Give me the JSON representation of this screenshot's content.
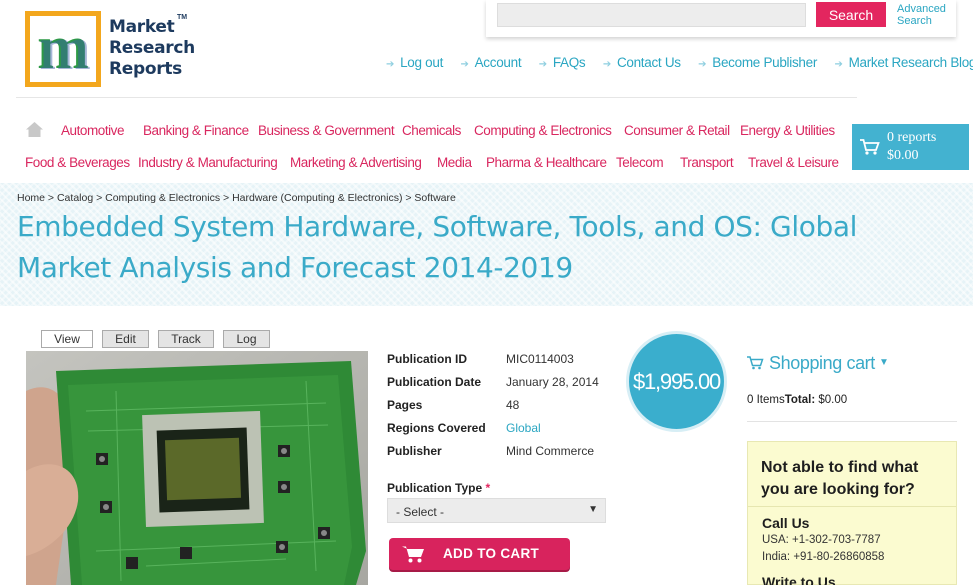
{
  "logo": {
    "line1": "Market",
    "line2": "Research",
    "line3": "Reports",
    "tm": "TM",
    "letter": "m"
  },
  "search": {
    "placeholder": "",
    "button_label": "Search",
    "advanced_label": "Advanced Search"
  },
  "top_links": [
    "Log out",
    "Account",
    "FAQs",
    "Contact Us",
    "Become Publisher",
    "Market Research Blog"
  ],
  "categories_row1": [
    "Automotive",
    "Banking & Finance",
    "Business & Government",
    "Chemicals",
    "Computing & Electronics",
    "Consumer & Retail",
    "Energy & Utilities"
  ],
  "categories_row2": [
    "Food & Beverages",
    "Industry & Manufacturing",
    "Marketing & Advertising",
    "Media",
    "Pharma & Healthcare",
    "Telecom",
    "Transport",
    "Travel & Leisure"
  ],
  "cart": {
    "count_label": "0 reports",
    "total_label": "$0.00"
  },
  "breadcrumb": "Home > Catalog > Computing & Electronics > Hardware (Computing & Electronics) > Software",
  "page_title": "Embedded System Hardware, Software, Tools, and OS: Global Market Analysis and Forecast 2014-2019",
  "tabs": {
    "view": "View",
    "edit": "Edit",
    "track": "Track",
    "log": "Log"
  },
  "details": {
    "id_label": "Publication ID",
    "id_value": "MIC0114003",
    "date_label": "Publication Date",
    "date_value": "January 28, 2014",
    "pages_label": "Pages",
    "pages_value": "48",
    "regions_label": "Regions Covered",
    "regions_value": "Global",
    "publisher_label": "Publisher",
    "publisher_value": "Mind Commerce"
  },
  "publication_type": {
    "label": "Publication Type",
    "required_mark": "*",
    "selected": "- Select -"
  },
  "add_to_cart_label": "ADD TO CART",
  "price": "$1,995.00",
  "sidebar": {
    "shopping_cart_title": "Shopping cart",
    "items_text": "0 Items",
    "total_label": "Total:",
    "total_value": "$0.00",
    "help_title": "Not able to find what you are looking for?",
    "call_us_title": "Call Us",
    "usa_phone": "USA: +1-302-703-7787",
    "india_phone": "India: +91-80-26860858",
    "write_title": "Write to Us"
  },
  "colors": {
    "accent": "#3aaac8",
    "brand_pink": "#d9275f",
    "logo_orange": "#f3a71d",
    "help_box": "#fbfbd0"
  },
  "icons": [
    "home-icon",
    "cart-icon",
    "shopping-cart-icon",
    "chevron-down-icon",
    "arrow-right-icon"
  ]
}
